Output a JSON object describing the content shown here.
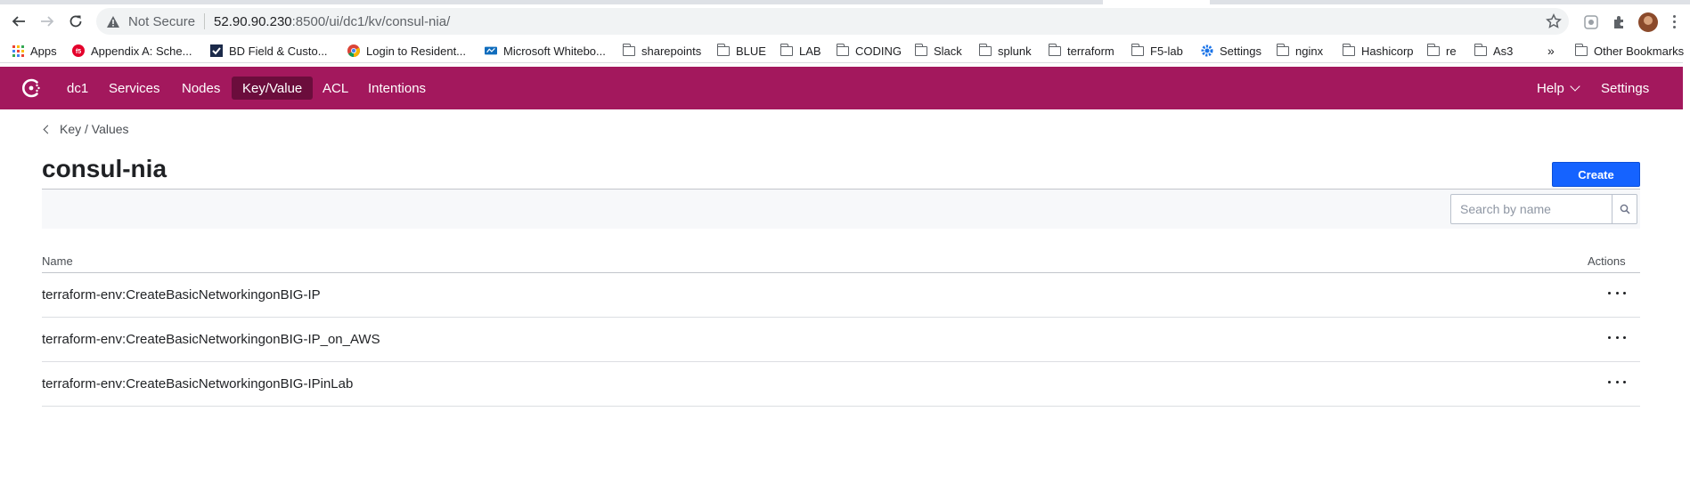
{
  "browser": {
    "address_bar": {
      "security_label": "Not Secure",
      "host": "52.90.90.230",
      "path": ":8500/ui/dc1/kv/consul-nia/"
    },
    "bookmarks": [
      {
        "label": "Apps",
        "icon": "apps-grid-icon"
      },
      {
        "label": "Appendix A: Sche...",
        "icon": "f5-logo-icon"
      },
      {
        "label": "BD Field & Custo...",
        "icon": "checkmark-logo-icon"
      },
      {
        "label": "Login to Resident...",
        "icon": "chrome-icon"
      },
      {
        "label": "Microsoft Whitebo...",
        "icon": "whiteboard-icon"
      },
      {
        "label": "sharepoints",
        "icon": "folder-icon"
      },
      {
        "label": "BLUE",
        "icon": "folder-icon"
      },
      {
        "label": "LAB",
        "icon": "folder-icon"
      },
      {
        "label": "CODING",
        "icon": "folder-icon"
      },
      {
        "label": "Slack",
        "icon": "folder-icon"
      },
      {
        "label": "splunk",
        "icon": "folder-icon"
      },
      {
        "label": "terraform",
        "icon": "folder-icon"
      },
      {
        "label": "F5-lab",
        "icon": "folder-icon"
      },
      {
        "label": "Settings",
        "icon": "gear-icon"
      },
      {
        "label": "nginx",
        "icon": "folder-icon"
      },
      {
        "label": "Hashicorp",
        "icon": "folder-icon"
      },
      {
        "label": "re",
        "icon": "folder-icon"
      },
      {
        "label": "As3",
        "icon": "folder-icon"
      }
    ],
    "overflow_label": "»",
    "other_bookmarks": "Other Bookmarks"
  },
  "app": {
    "brand_color": "#a3185d",
    "active_color": "#6b0d3c",
    "primary_button_color": "#1563ff",
    "nav": {
      "datacenter": "dc1",
      "items": [
        "Services",
        "Nodes",
        "Key/Value",
        "ACL",
        "Intentions"
      ],
      "active": "Key/Value",
      "help": "Help",
      "settings": "Settings"
    },
    "breadcrumb": "Key / Values",
    "title": "consul-nia",
    "create_label": "Create",
    "search_placeholder": "Search by name",
    "table": {
      "columns": {
        "name": "Name",
        "actions": "Actions"
      },
      "rows": [
        "terraform-env:CreateBasicNetworkingonBIG-IP",
        "terraform-env:CreateBasicNetworkingonBIG-IP_on_AWS",
        "terraform-env:CreateBasicNetworkingonBIG-IPinLab"
      ]
    }
  }
}
